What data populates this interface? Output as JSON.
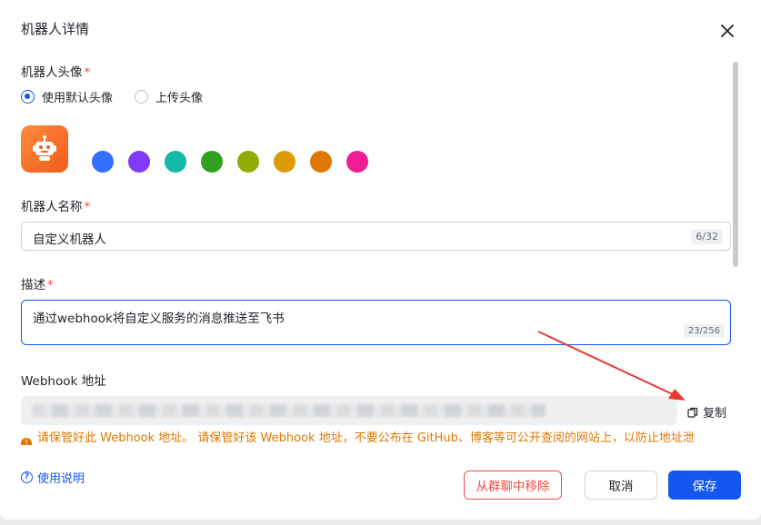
{
  "dialog": {
    "title": "机器人详情"
  },
  "avatar_section": {
    "label": "机器人头像",
    "required_mark": "*",
    "options": [
      {
        "label": "使用默认头像",
        "checked": true
      },
      {
        "label": "上传头像",
        "checked": false
      }
    ],
    "swatches": [
      "#3370ff",
      "#7f3bf5",
      "#14b8a6",
      "#2ea121",
      "#8fac02",
      "#dc9b04",
      "#de7802",
      "#f01d94"
    ]
  },
  "name_section": {
    "label": "机器人名称",
    "required_mark": "*",
    "value": "自定义机器人",
    "counter": "6/32"
  },
  "desc_section": {
    "label": "描述",
    "required_mark": "*",
    "value": "通过webhook将自定义服务的消息推送至飞书",
    "counter": "23/256"
  },
  "webhook_section": {
    "label": "Webhook 地址",
    "copy_label": "复制",
    "warning": "请保管好此 Webhook 地址。 请保管好该 Webhook 地址，不要公布在 GitHub、博客等可公开查阅的网站上，以防止地址泄"
  },
  "footer": {
    "help_label": "使用说明",
    "remove_label": "从群聊中移除",
    "cancel_label": "取消",
    "save_label": "保存"
  },
  "colors": {
    "accent": "#1456f0",
    "danger": "#f54a45",
    "warning": "#de7802",
    "annotation_arrow": "#e8392f"
  }
}
